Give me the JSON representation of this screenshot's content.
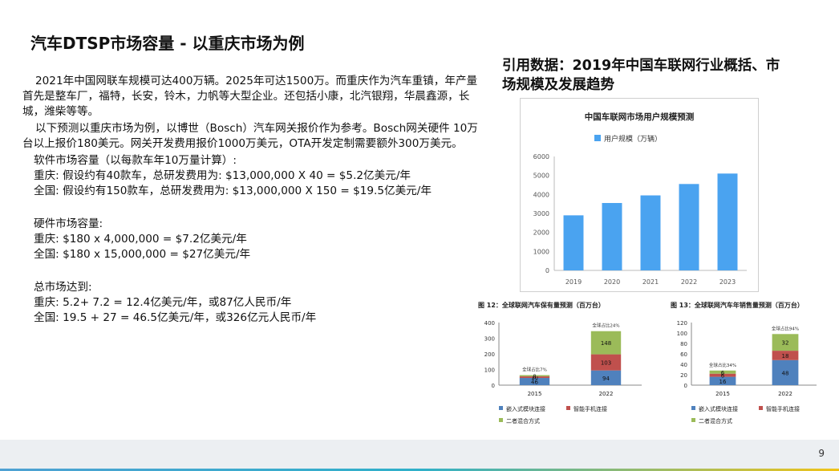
{
  "slide": {
    "title": "汽车DTSP市场容量 - 以重庆市场为例",
    "page_number": "9"
  },
  "body": {
    "para1": "2021年中国网联车规模可达400万辆。2025年可达1500万。而重庆作为汽车重镇，年产量首先是整车厂，福特，长安，铃木，力帆等大型企业。还包括小康，北汽银翔，华晨鑫源，长城，潍柴等等。",
    "para2": "以下预测以重庆市场为例，以博世（Bosch）汽车网关报价作为参考。Bosch网关硬件 10万台以上报价180美元。网关开发费用报价1000万美元，OTA开发定制需要额外300万美元。",
    "software_heading": "软件市场容量（以每款车年10万量计算）:",
    "software_cq": "重庆: 假设约有40款车，总研发费用为:  $13,000,000 X 40 = $5.2亿美元/年",
    "software_cn": "全国: 假设约有150款车，总研发费用为: $13,000,000 X 150 = $19.5亿美元/年",
    "hardware_heading": "硬件市场容量:",
    "hardware_cq": "重庆: $180 x 4,000,000 = $7.2亿美元/年",
    "hardware_cn": "全国: $180 x 15,000,000 = $27亿美元/年",
    "total_heading": "总市场达到:",
    "total_cq": "重庆: 5.2+ 7.2 = 12.4亿美元/年，或87亿人民币/年",
    "total_cn": "全国: 19.5 + 27 = 46.5亿美元/年，或326亿元人民币/年"
  },
  "citation": {
    "title": "引用数据：2019年中国车联网行业概括、市场规模及发展趋势"
  },
  "chart_data": [
    {
      "type": "bar",
      "title": "中国车联网市场用户规模预测",
      "legend": "用户规模（万辆）",
      "legend_position": "top",
      "categories": [
        "2019",
        "2020",
        "2021",
        "2022",
        "2023"
      ],
      "values": [
        2900,
        3550,
        3950,
        4550,
        5100
      ],
      "yticks": [
        "0",
        "1000",
        "2000",
        "3000",
        "4000",
        "5000",
        "6000"
      ],
      "ylim": [
        0,
        6000
      ],
      "color": "#4aa3f0",
      "grid": false
    },
    {
      "type": "bar",
      "stacked": true,
      "title": "图 12：全球联网汽车保有量预测（百万台）",
      "categories": [
        "2015",
        "2022"
      ],
      "series": [
        {
          "name": "嵌入式模块连接",
          "values": [
            46,
            94
          ],
          "color": "#4f81bd"
        },
        {
          "name": "智能手机连接",
          "values": [
            10,
            103
          ],
          "color": "#c0504d"
        },
        {
          "name": "二者混合方式",
          "values": [
            8,
            148
          ],
          "color": "#9bbb59"
        }
      ],
      "annotations": [
        "全球占比7%",
        "全球占比24%"
      ],
      "yticks": [
        "0",
        "100",
        "200",
        "300",
        "400"
      ],
      "ylim": [
        0,
        400
      ],
      "grid": false
    },
    {
      "type": "bar",
      "stacked": true,
      "title": "图 13：全球联网汽车年销售量预测（百万台）",
      "categories": [
        "2015",
        "2022"
      ],
      "series": [
        {
          "name": "嵌入式模块连接",
          "values": [
            16,
            48
          ],
          "color": "#4f81bd"
        },
        {
          "name": "智能手机连接",
          "values": [
            6,
            18
          ],
          "color": "#c0504d"
        },
        {
          "name": "二者混合方式",
          "values": [
            6,
            32
          ],
          "color": "#9bbb59"
        }
      ],
      "annotations": [
        "全球占比34%",
        "全球占比94%"
      ],
      "yticks": [
        "0",
        "20",
        "40",
        "60",
        "80",
        "100",
        "120"
      ],
      "ylim": [
        0,
        120
      ],
      "grid": false
    }
  ]
}
